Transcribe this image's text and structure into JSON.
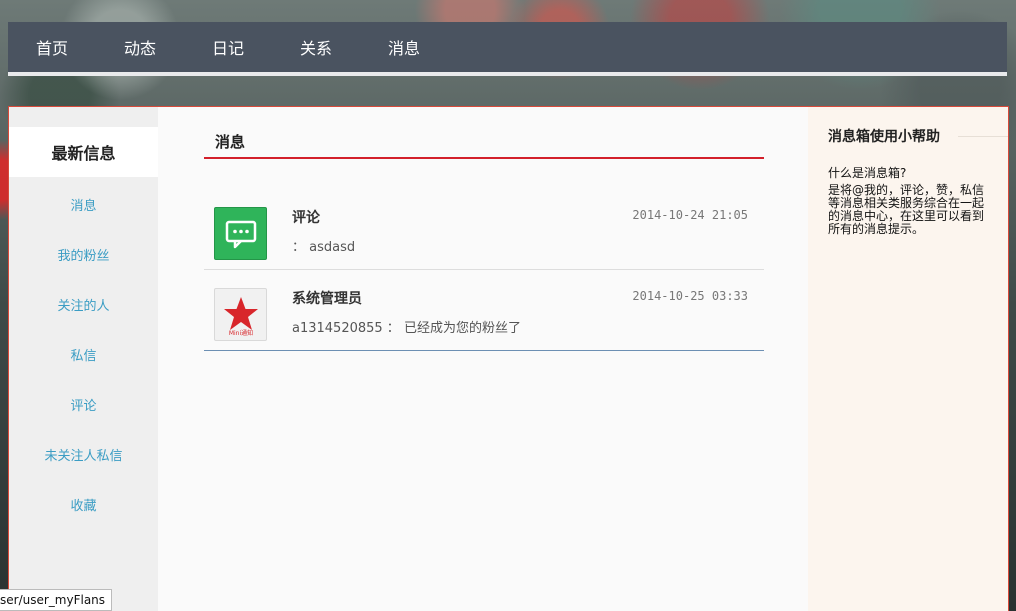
{
  "nav": {
    "items": [
      "首页",
      "动态",
      "日记",
      "关系",
      "消息"
    ],
    "active_index": 4
  },
  "sidebar": {
    "heading": "最新信息",
    "items": [
      "消息",
      "我的粉丝",
      "关注的人",
      "私信",
      "评论",
      "未关注人私信",
      "收藏"
    ]
  },
  "content": {
    "title": "消息",
    "messages": [
      {
        "author": "评论",
        "time": "2014-10-24 21:05",
        "text": "： asdasd",
        "icon": "comment-icon"
      },
      {
        "author": "系统管理员",
        "time": "2014-10-25 03:33",
        "text": "a1314520855 ： 已经成为您的粉丝了",
        "icon": "red-star-logo",
        "logo_text": "Mini通知"
      }
    ]
  },
  "help": {
    "title": "消息箱使用小帮助",
    "question": "什么是消息箱?",
    "answer": "是将@我的，评论，赞，私信等消息相关类服务综合在一起的消息中心，在这里可以看到所有的消息提示。"
  },
  "status_bar": {
    "url": "ser/user_myFlans"
  },
  "colors": {
    "nav_bg": "#4a5360",
    "nav_active": "#e04a1e",
    "title_rule": "#d3202b",
    "link": "#3b9dc4"
  }
}
